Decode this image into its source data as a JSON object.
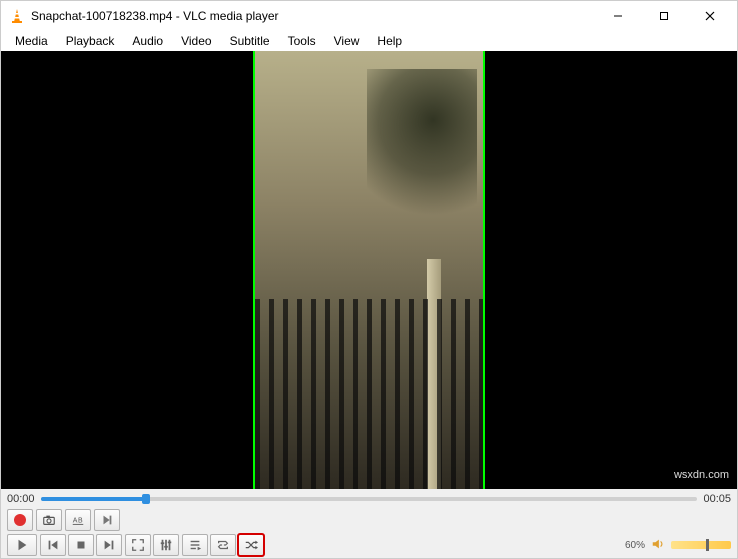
{
  "titlebar": {
    "title": "Snapchat-100718238.mp4 - VLC media player"
  },
  "menu": {
    "items": [
      "Media",
      "Playback",
      "Audio",
      "Video",
      "Subtitle",
      "Tools",
      "View",
      "Help"
    ]
  },
  "watermark": "wsxdn.com",
  "time": {
    "current": "00:00",
    "total": "00:05",
    "progress_pct": 16
  },
  "volume": {
    "percent_label": "60%",
    "percent": 60
  },
  "icons": {
    "record": "record",
    "snapshot": "snapshot",
    "ab_loop": "ab-loop",
    "frame_step": "frame-step",
    "play": "play",
    "prev": "previous",
    "stop": "stop",
    "next": "next",
    "fullscreen": "fullscreen",
    "ext_settings": "extended-settings",
    "playlist": "playlist",
    "loop": "loop",
    "shuffle": "shuffle",
    "speaker": "speaker"
  }
}
